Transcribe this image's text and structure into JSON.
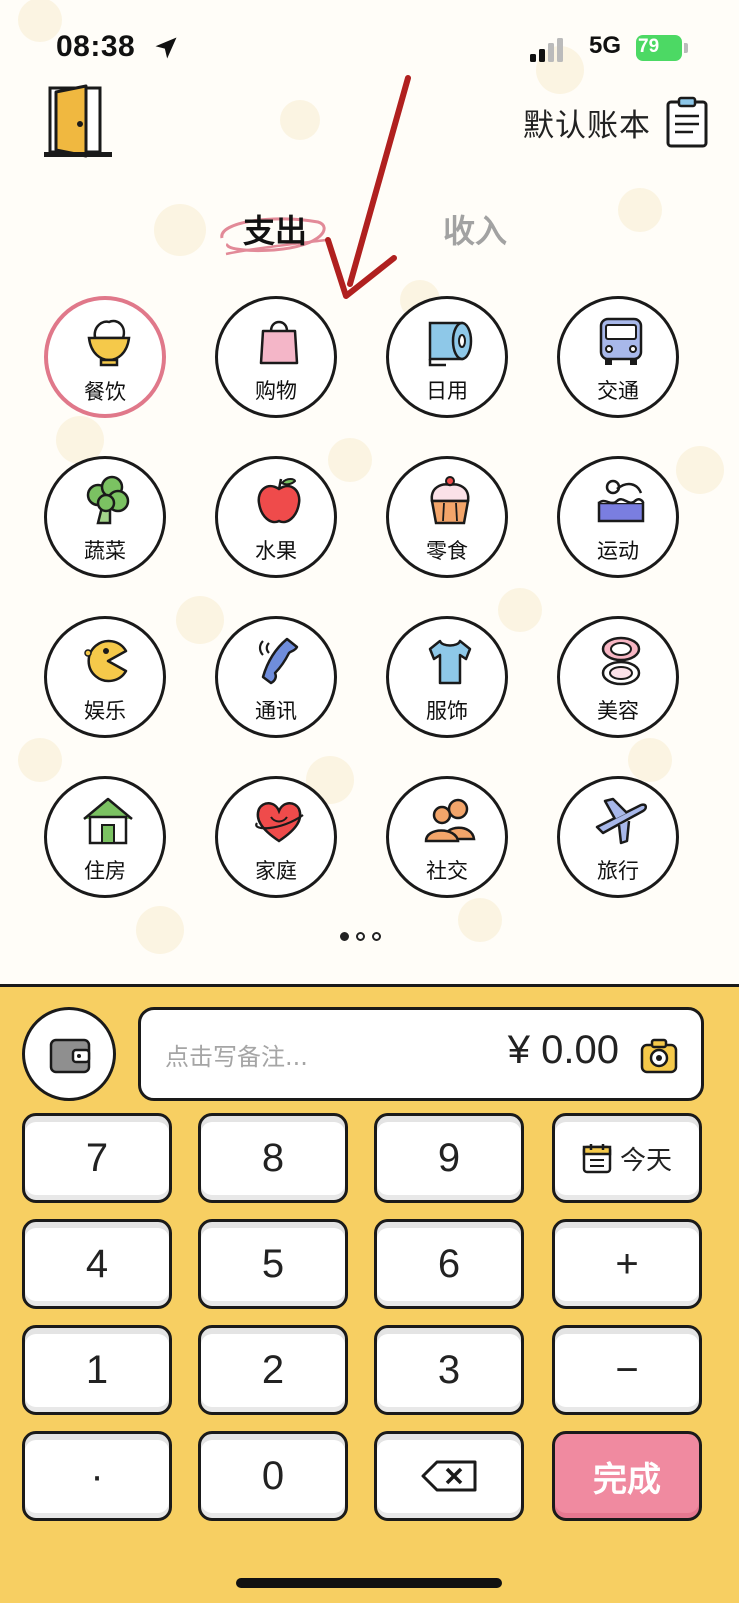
{
  "status": {
    "time": "08:38",
    "network": "5G",
    "battery": "79"
  },
  "header": {
    "ledger_title": "默认账本"
  },
  "tabs": {
    "expense": "支出",
    "income": "收入"
  },
  "categories": [
    {
      "label": "餐饮",
      "icon": "rice-bowl-icon",
      "selected": true
    },
    {
      "label": "购物",
      "icon": "shopping-bag-icon"
    },
    {
      "label": "日用",
      "icon": "tissue-roll-icon"
    },
    {
      "label": "交通",
      "icon": "bus-icon"
    },
    {
      "label": "蔬菜",
      "icon": "broccoli-icon"
    },
    {
      "label": "水果",
      "icon": "apple-icon"
    },
    {
      "label": "零食",
      "icon": "cupcake-icon"
    },
    {
      "label": "运动",
      "icon": "swimming-icon"
    },
    {
      "label": "娱乐",
      "icon": "pacman-icon"
    },
    {
      "label": "通讯",
      "icon": "phone-icon"
    },
    {
      "label": "服饰",
      "icon": "tshirt-icon"
    },
    {
      "label": "美容",
      "icon": "compact-mirror-icon"
    },
    {
      "label": "住房",
      "icon": "house-icon"
    },
    {
      "label": "家庭",
      "icon": "heart-icon"
    },
    {
      "label": "社交",
      "icon": "people-icon"
    },
    {
      "label": "旅行",
      "icon": "airplane-icon"
    }
  ],
  "pager": {
    "pages": 3,
    "current": 1
  },
  "entry": {
    "note_placeholder": "点击写备注...",
    "amount": "¥ 0.00"
  },
  "keypad": {
    "k7": "7",
    "k8": "8",
    "k9": "9",
    "today": "今天",
    "k4": "4",
    "k5": "5",
    "k6": "6",
    "plus": "+",
    "k1": "1",
    "k2": "2",
    "k3": "3",
    "minus": "−",
    "dot": "·",
    "k0": "0",
    "done": "完成"
  },
  "colors": {
    "keyboard_bg": "#f7cf62",
    "selected_ring": "#e0788a",
    "done_button": "#f08aa0",
    "arrow": "#b0201f"
  }
}
